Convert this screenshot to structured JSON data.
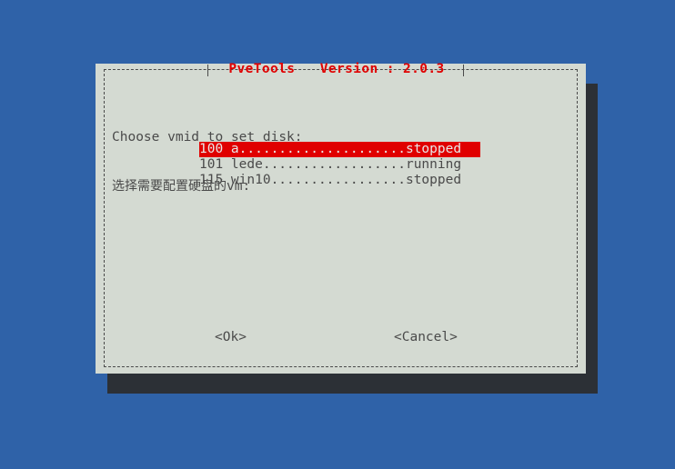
{
  "desktop": {
    "background_color": "#2f62a8"
  },
  "dialog": {
    "title": "PveTools   Version : 2.0.3",
    "app_name": "PveTools",
    "version_label": "Version : 2.0.3",
    "title_color": "#e00000",
    "background_color": "#d4dad2",
    "border_color": "#4a4a4a",
    "shadow_color": "#2c3036",
    "prompt_en": "Choose vmid to set disk:",
    "prompt_cn_hanzi": "选择需要配置硬盘的",
    "prompt_cn_latin": "vm:",
    "highlight_color": "#e00000",
    "highlight_text_color": "#e8e8e8"
  },
  "vm_list": {
    "items": [
      {
        "vmid": "100",
        "name": "a",
        "status": "stopped",
        "line": "100 a.....................stopped",
        "selected": true
      },
      {
        "vmid": "101",
        "name": "lede",
        "status": "running",
        "line": "101 lede..................running",
        "selected": false
      },
      {
        "vmid": "115",
        "name": "win10",
        "status": "stopped",
        "line": "115 win10.................stopped",
        "selected": false
      }
    ]
  },
  "buttons": {
    "ok": "<Ok>",
    "cancel": "<Cancel>"
  }
}
